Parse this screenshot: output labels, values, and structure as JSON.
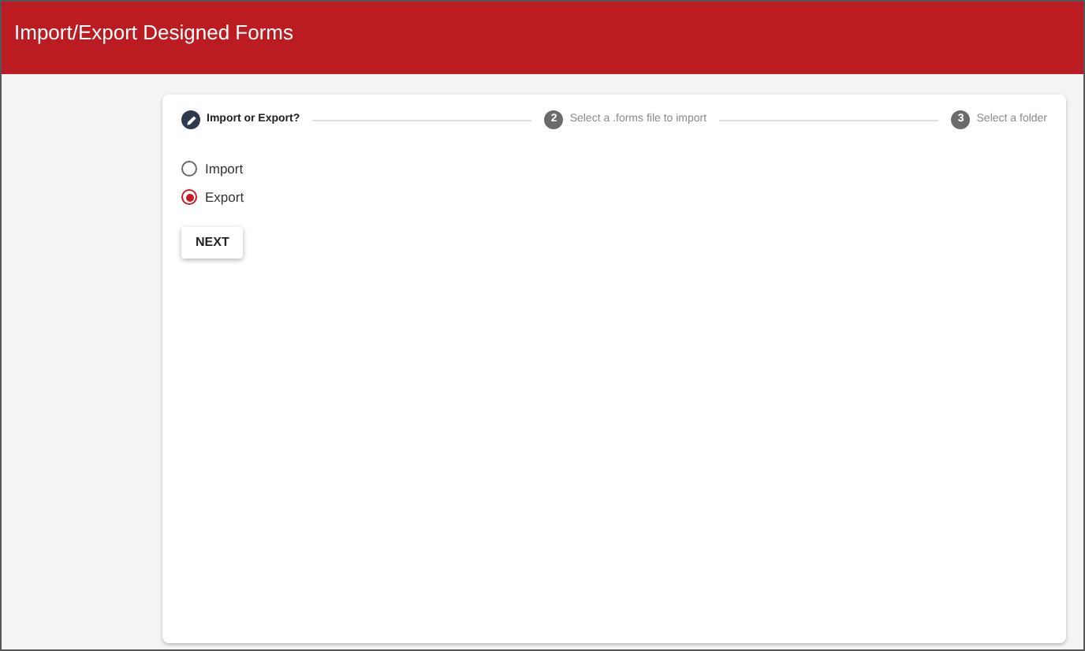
{
  "header": {
    "title": "Import/Export Designed Forms"
  },
  "steps": [
    {
      "label": "Import or Export?",
      "selected": true
    },
    {
      "label": "Select a .forms file to import",
      "number": "2",
      "selected": false
    },
    {
      "label": "Select a folder",
      "number": "3",
      "selected": false
    }
  ],
  "options": [
    {
      "label": "Import",
      "selected": false
    },
    {
      "label": "Export",
      "selected": true
    }
  ],
  "button": "NEXT"
}
